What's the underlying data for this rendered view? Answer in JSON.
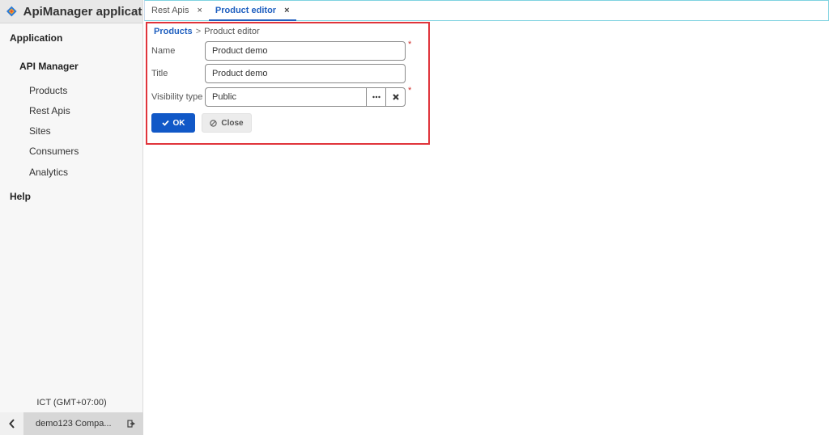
{
  "app": {
    "title": "ApiManager applicati..."
  },
  "sidebar": {
    "application_label": "Application",
    "api_manager_label": "API Manager",
    "items": [
      {
        "label": "Products"
      },
      {
        "label": "Rest Apis"
      },
      {
        "label": "Sites"
      },
      {
        "label": "Consumers"
      },
      {
        "label": "Analytics"
      }
    ],
    "help_label": "Help",
    "timezone": "ICT (GMT+07:00)",
    "user": "demo123 Compa..."
  },
  "tabs": [
    {
      "label": "Rest Apis",
      "close": "×",
      "active": false
    },
    {
      "label": "Product editor",
      "close": "×",
      "active": true
    }
  ],
  "editor": {
    "breadcrumb": {
      "parent": "Products",
      "separator": ">",
      "current": "Product editor"
    },
    "name_label": "Name",
    "name_value": "Product demo",
    "title_label": "Title",
    "title_value": "Product demo",
    "visibility_label": "Visibility type",
    "visibility_value": "Public",
    "required_mark": "*",
    "ok_label": "OK",
    "close_label": "Close"
  },
  "colors": {
    "accent": "#1158c7",
    "link": "#1f5fbf",
    "highlight_border": "#e0343b",
    "required": "#d0312d"
  },
  "icons": [
    "app-logo-icon",
    "chevron-left-icon",
    "logout-icon",
    "ellipsis-icon",
    "clear-icon",
    "check-icon",
    "ban-icon"
  ]
}
